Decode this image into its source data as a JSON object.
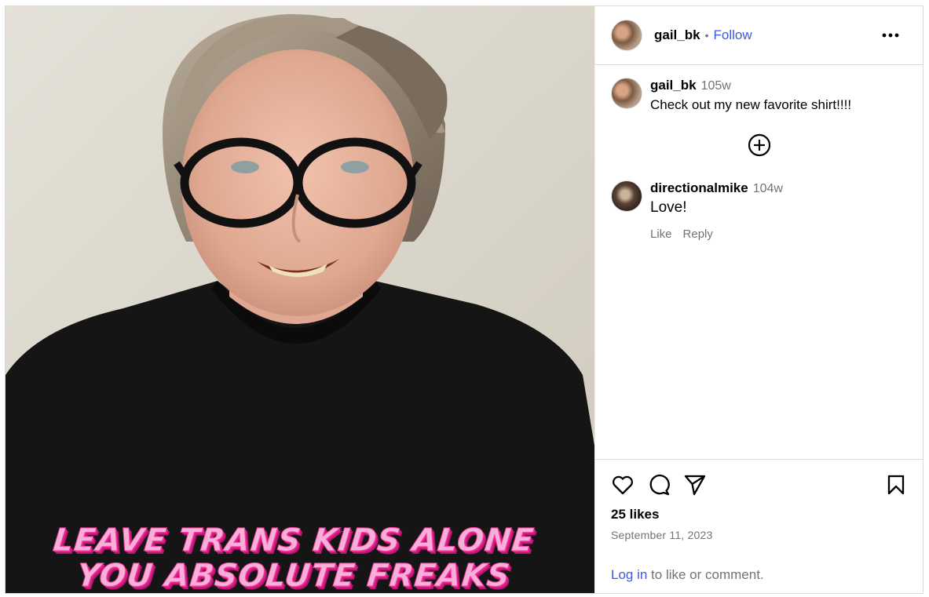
{
  "post": {
    "author": "gail_bk",
    "follow_label": "Follow",
    "separator": "•",
    "more_icon": "more-horizontal-icon",
    "image_shirt_lines": [
      "LEAVE TRANS KIDS ALONE",
      "YOU ABSOLUTE FREAKS"
    ]
  },
  "caption": {
    "user": "gail_bk",
    "time": "105w",
    "text": "Check out my new favorite shirt!!!!"
  },
  "load_more_icon": "plus-circle-icon",
  "comments": [
    {
      "user": "directionalmike",
      "time": "104w",
      "text": "Love!",
      "like_label": "Like",
      "reply_label": "Reply"
    }
  ],
  "actions": {
    "like_icon": "heart-icon",
    "comment_icon": "comment-icon",
    "share_icon": "send-icon",
    "save_icon": "bookmark-icon"
  },
  "likes_text": "25 likes",
  "date": "September 11, 2023",
  "login": {
    "link": "Log in",
    "rest": " to like or comment."
  },
  "colors": {
    "link": "#3b5bdb",
    "muted": "#737373",
    "border": "#dbdbdb"
  }
}
